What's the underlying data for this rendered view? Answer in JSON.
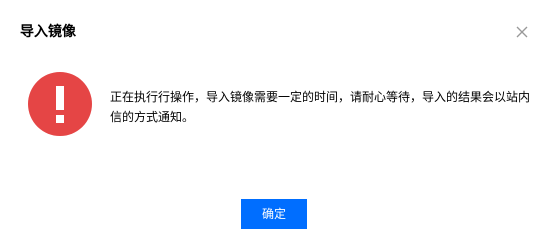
{
  "dialog": {
    "title": "导入镜像",
    "message": "正在执行行操作，导入镜像需要一定的时间，请耐心等待，导入的结果会以站内信的方式通知。",
    "confirm_label": "确定",
    "close_icon": "close-icon",
    "status_icon": "exclamation-circle-icon"
  },
  "colors": {
    "alert_red": "#e54545",
    "primary_blue": "#006eff",
    "close_gray": "#999999"
  }
}
